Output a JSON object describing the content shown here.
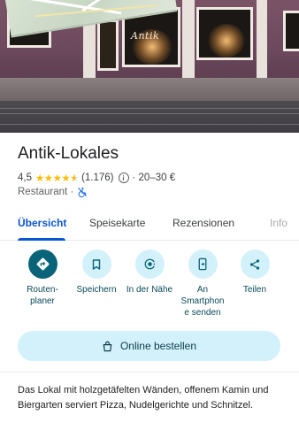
{
  "place": {
    "name": "Antik-Lokales",
    "rating": "4,5",
    "stars": 4.5,
    "review_count": "(1.176)",
    "price": "· 20–30 €",
    "category": "Restaurant ·",
    "sign_text": "Antik"
  },
  "tabs": [
    {
      "label": "Übersicht",
      "active": true
    },
    {
      "label": "Speisekarte",
      "active": false
    },
    {
      "label": "Rezensionen",
      "active": false
    },
    {
      "label": "Info",
      "active": false
    }
  ],
  "actions": [
    {
      "label": "Routen-\nplaner",
      "icon": "directions-icon"
    },
    {
      "label": "Speichern",
      "icon": "bookmark-icon"
    },
    {
      "label": "In der Nähe",
      "icon": "nearby-icon"
    },
    {
      "label": "An\nSmartphon\ne senden",
      "icon": "send-to-phone-icon"
    },
    {
      "label": "Teilen",
      "icon": "share-icon"
    }
  ],
  "order": {
    "label": "Online bestellen",
    "icon": "shopping-bag-icon"
  },
  "description": "Das Lokal mit holzgetäfelten Wänden, offenem Kamin und Biergarten serviert Pizza, Nudelgerichte und Schnitzel.",
  "colors": {
    "accent": "#0b57d0",
    "action_bg": "#d3f1fb",
    "action_primary": "#0a6479",
    "star": "#fbbc04"
  }
}
